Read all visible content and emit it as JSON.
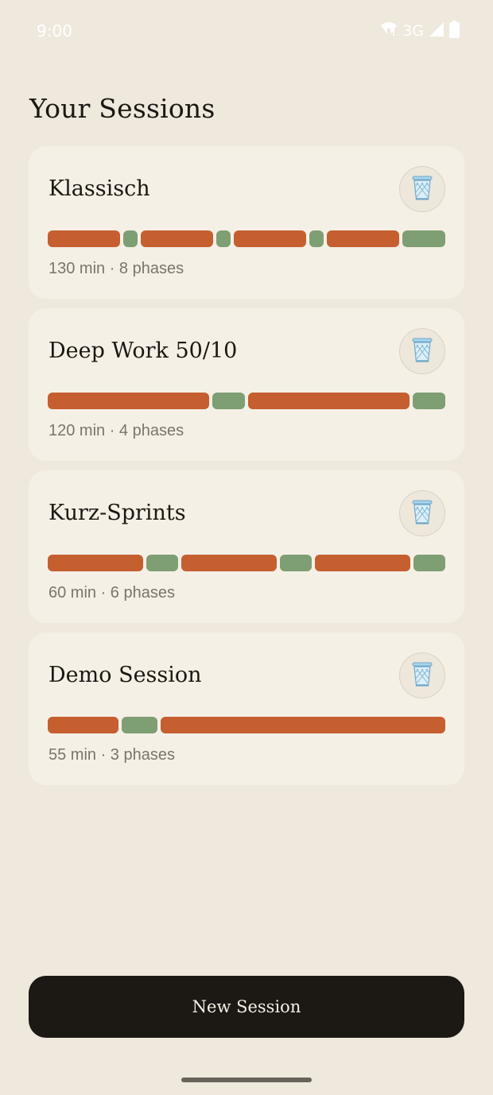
{
  "status_bar": {
    "time": "9:00",
    "network": "3G",
    "icons": [
      "wifi-icon",
      "cell-signal-icon",
      "battery-icon"
    ]
  },
  "title": "Your Sessions",
  "colors": {
    "focus": "#C55F30",
    "break": "#7E9E73",
    "background": "#EFE8DD",
    "card": "#F5F0E6",
    "button": "#1C1813"
  },
  "sessions": [
    {
      "name": "Klassisch",
      "meta": "130 min · 8 phases",
      "phases": [
        {
          "kind": "focus",
          "minutes": 25
        },
        {
          "kind": "break",
          "minutes": 5
        },
        {
          "kind": "focus",
          "minutes": 25
        },
        {
          "kind": "break",
          "minutes": 5
        },
        {
          "kind": "focus",
          "minutes": 25
        },
        {
          "kind": "break",
          "minutes": 5
        },
        {
          "kind": "focus",
          "minutes": 25
        },
        {
          "kind": "break",
          "minutes": 15
        }
      ]
    },
    {
      "name": "Deep Work 50/10",
      "meta": "120 min · 4 phases",
      "phases": [
        {
          "kind": "focus",
          "minutes": 50
        },
        {
          "kind": "break",
          "minutes": 10
        },
        {
          "kind": "focus",
          "minutes": 50
        },
        {
          "kind": "break",
          "minutes": 10
        }
      ]
    },
    {
      "name": "Kurz-Sprints",
      "meta": "60 min · 6 phases",
      "phases": [
        {
          "kind": "focus",
          "minutes": 15
        },
        {
          "kind": "break",
          "minutes": 5
        },
        {
          "kind": "focus",
          "minutes": 15
        },
        {
          "kind": "break",
          "minutes": 5
        },
        {
          "kind": "focus",
          "minutes": 15
        },
        {
          "kind": "break",
          "minutes": 5
        }
      ]
    },
    {
      "name": "Demo Session",
      "meta": "55 min · 3 phases",
      "phases": [
        {
          "kind": "focus",
          "minutes": 10
        },
        {
          "kind": "break",
          "minutes": 5
        },
        {
          "kind": "focus",
          "minutes": 40
        }
      ]
    }
  ],
  "new_session_label": "New Session"
}
